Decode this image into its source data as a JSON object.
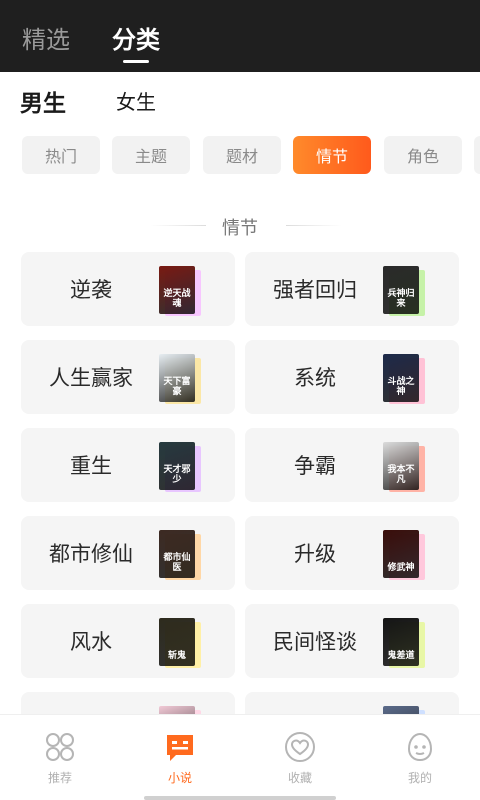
{
  "top_tabs": [
    {
      "label": "精选",
      "active": false
    },
    {
      "label": "分类",
      "active": true
    }
  ],
  "gender_tabs": [
    {
      "label": "男生",
      "active": true
    },
    {
      "label": "女生",
      "active": false
    }
  ],
  "filter_chips": [
    {
      "label": "热门",
      "active": false
    },
    {
      "label": "主题",
      "active": false
    },
    {
      "label": "题材",
      "active": false
    },
    {
      "label": "情节",
      "active": true
    },
    {
      "label": "角色",
      "active": false
    }
  ],
  "section": {
    "title": "情节"
  },
  "categories": [
    {
      "label": "逆袭",
      "cover_title": "逆天战魂",
      "cover_color": "#7a1a12",
      "accent": "#f7c6ff"
    },
    {
      "label": "强者回归",
      "cover_title": "兵神归来",
      "cover_color": "#2a2a2a",
      "accent": "#c6f2a8"
    },
    {
      "label": "人生赢家",
      "cover_title": "天下富豪",
      "cover_color": "#e7eef2",
      "accent": "#fbe7a6"
    },
    {
      "label": "系统",
      "cover_title": "斗战之神",
      "cover_color": "#1d2a4a",
      "accent": "#ffc2d6"
    },
    {
      "label": "重生",
      "cover_title": "天才邪少",
      "cover_color": "#263a3f",
      "accent": "#e8c6ff"
    },
    {
      "label": "争霸",
      "cover_title": "我本不凡",
      "cover_color": "#dcdcdc",
      "accent": "#ffb3a6"
    },
    {
      "label": "都市修仙",
      "cover_title": "都市仙医",
      "cover_color": "#3d2a22",
      "accent": "#ffd7a6"
    },
    {
      "label": "升级",
      "cover_title": "修武神",
      "cover_color": "#3a0d0a",
      "accent": "#ffc8dc"
    },
    {
      "label": "风水",
      "cover_title": "斩鬼",
      "cover_color": "#2e2b1d",
      "accent": "#fff0a6"
    },
    {
      "label": "民间怪谈",
      "cover_title": "鬼差道",
      "cover_color": "#151515",
      "accent": "#e8f7a6"
    },
    {
      "label": "",
      "cover_title": "",
      "cover_color": "#f2c9d6",
      "accent": "#ffd7e6"
    },
    {
      "label": "",
      "cover_title": "",
      "cover_color": "#5a6a8a",
      "accent": "#cfe0ff"
    }
  ],
  "bottom_nav": [
    {
      "label": "推荐",
      "icon": "grid-icon",
      "active": false
    },
    {
      "label": "小说",
      "icon": "book-chat-icon",
      "active": true
    },
    {
      "label": "收藏",
      "icon": "heart-icon",
      "active": false
    },
    {
      "label": "我的",
      "icon": "profile-icon",
      "active": false
    }
  ],
  "colors": {
    "accent": "#ff6a1e",
    "topbar": "#1f1f1f"
  }
}
